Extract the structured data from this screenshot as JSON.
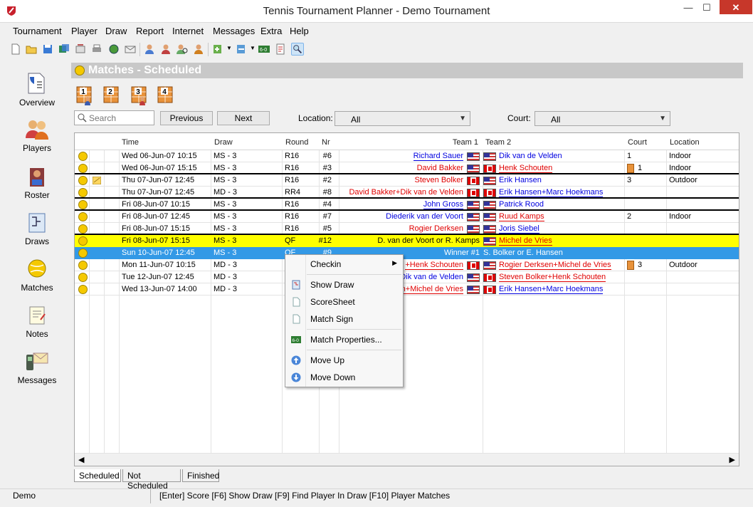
{
  "window": {
    "title": "Tennis Tournament Planner - Demo Tournament",
    "min_glyph": "—",
    "max_glyph": "☐",
    "close_glyph": "✕"
  },
  "menu": {
    "items": [
      "Tournament",
      "Player",
      "Draw",
      "Report",
      "Internet",
      "Messages",
      "Extra",
      "Help"
    ]
  },
  "sidebar": {
    "items": [
      {
        "label": "Overview",
        "icon": "overview-icon"
      },
      {
        "label": "Players",
        "icon": "players-icon"
      },
      {
        "label": "Roster",
        "icon": "roster-icon"
      },
      {
        "label": "Draws",
        "icon": "draws-icon"
      },
      {
        "label": "Matches",
        "icon": "matches-icon"
      },
      {
        "label": "Notes",
        "icon": "notes-icon"
      },
      {
        "label": "Messages",
        "icon": "messages-icon"
      }
    ]
  },
  "page": {
    "title": "Matches - Scheduled"
  },
  "court_buttons": [
    "1",
    "2",
    "3",
    "4"
  ],
  "filters": {
    "search_placeholder": "Search",
    "previous_label": "Previous",
    "next_label": "Next",
    "location_label": "Location:",
    "location_value": "All",
    "court_label": "Court:",
    "court_value": "All"
  },
  "grid": {
    "columns": [
      "Time",
      "Draw",
      "Round",
      "Nr",
      "Team 1",
      "Team 2",
      "Court",
      "Location"
    ],
    "rows": [
      {
        "time": "Wed 06-Jun-07 10:15",
        "draw": "MS - 3",
        "round": "R16",
        "nr": "#6",
        "team1": "Richard Sauer",
        "team2": "Dik van de Velden",
        "court": "1",
        "location": "Indoor"
      },
      {
        "time": "Wed 06-Jun-07 15:15",
        "draw": "MS - 3",
        "round": "R16",
        "nr": "#3",
        "team1": "David Bakker",
        "team2": "Henk Schouten",
        "court": "1",
        "location": "Indoor"
      },
      {
        "time": "Thu 07-Jun-07 12:45",
        "draw": "MS - 3",
        "round": "R16",
        "nr": "#2",
        "team1": "Steven Bolker",
        "team2": "Erik Hansen",
        "court": "3",
        "location": "Outdoor"
      },
      {
        "time": "Thu 07-Jun-07 12:45",
        "draw": "MD - 3",
        "round": "RR4",
        "nr": "#8",
        "team1": "David Bakker+Dik van de Velden",
        "team2": "Erik Hansen+Marc Hoekmans",
        "court": "",
        "location": ""
      },
      {
        "time": "Fri 08-Jun-07 10:15",
        "draw": "MS - 3",
        "round": "R16",
        "nr": "#4",
        "team1": "John Gross",
        "team2": "Patrick Rood",
        "court": "",
        "location": ""
      },
      {
        "time": "Fri 08-Jun-07 12:45",
        "draw": "MS - 3",
        "round": "R16",
        "nr": "#7",
        "team1": "Diederik van der Voort",
        "team2": "Ruud Kamps",
        "court": "2",
        "location": "Indoor"
      },
      {
        "time": "Fri 08-Jun-07 15:15",
        "draw": "MS - 3",
        "round": "R16",
        "nr": "#5",
        "team1": "Rogier Derksen",
        "team2": "Joris Siebel",
        "court": "",
        "location": ""
      },
      {
        "time": "Fri 08-Jun-07 15:15",
        "draw": "MS - 3",
        "round": "QF",
        "nr": "#12",
        "team1": "D. van der Voort or R. Kamps",
        "team2": "Michel de Vries",
        "court": "",
        "location": ""
      },
      {
        "time": "Sun 10-Jun-07 12:45",
        "draw": "MS - 3",
        "round": "QF",
        "nr": "#9",
        "team1": "Winner #1",
        "team2": "S. Bolker or E. Hansen",
        "court": "",
        "location": ""
      },
      {
        "time": "Mon 11-Jun-07 10:15",
        "draw": "MD - 3",
        "round": "",
        "nr": "",
        "team1": "+Henk Schouten",
        "team2": "Rogier Derksen+Michel de Vries",
        "court": "3",
        "location": "Outdoor"
      },
      {
        "time": "Tue 12-Jun-07 12:45",
        "draw": "MD - 3",
        "round": "",
        "nr": "",
        "team1": "Dik van de Velden",
        "team2": "Steven Bolker+Henk Schouten",
        "court": "",
        "location": ""
      },
      {
        "time": "Wed 13-Jun-07 14:00",
        "draw": "MD - 3",
        "round": "",
        "nr": "",
        "team1": "n+Michel de Vries",
        "team2": "Erik Hansen+Marc Hoekmans",
        "court": "",
        "location": ""
      }
    ]
  },
  "tabs": [
    "Scheduled",
    "Not Scheduled",
    "Finished"
  ],
  "context_menu": {
    "items": [
      "Checkin",
      "Show Draw",
      "ScoreSheet",
      "Match Sign",
      "Match Properties...",
      "Move Up",
      "Move Down"
    ]
  },
  "status": {
    "left": "Demo",
    "right": "[Enter] Score [F6] Show Draw [F9] Find Player In Draw  [F10] Player Matches"
  },
  "colors": {
    "selected_row": "#3399e6",
    "highlight_row": "#ffff00",
    "player_red": "#e00000",
    "player_blue": "#0000e0",
    "header_bar": "#c8c8c8"
  }
}
